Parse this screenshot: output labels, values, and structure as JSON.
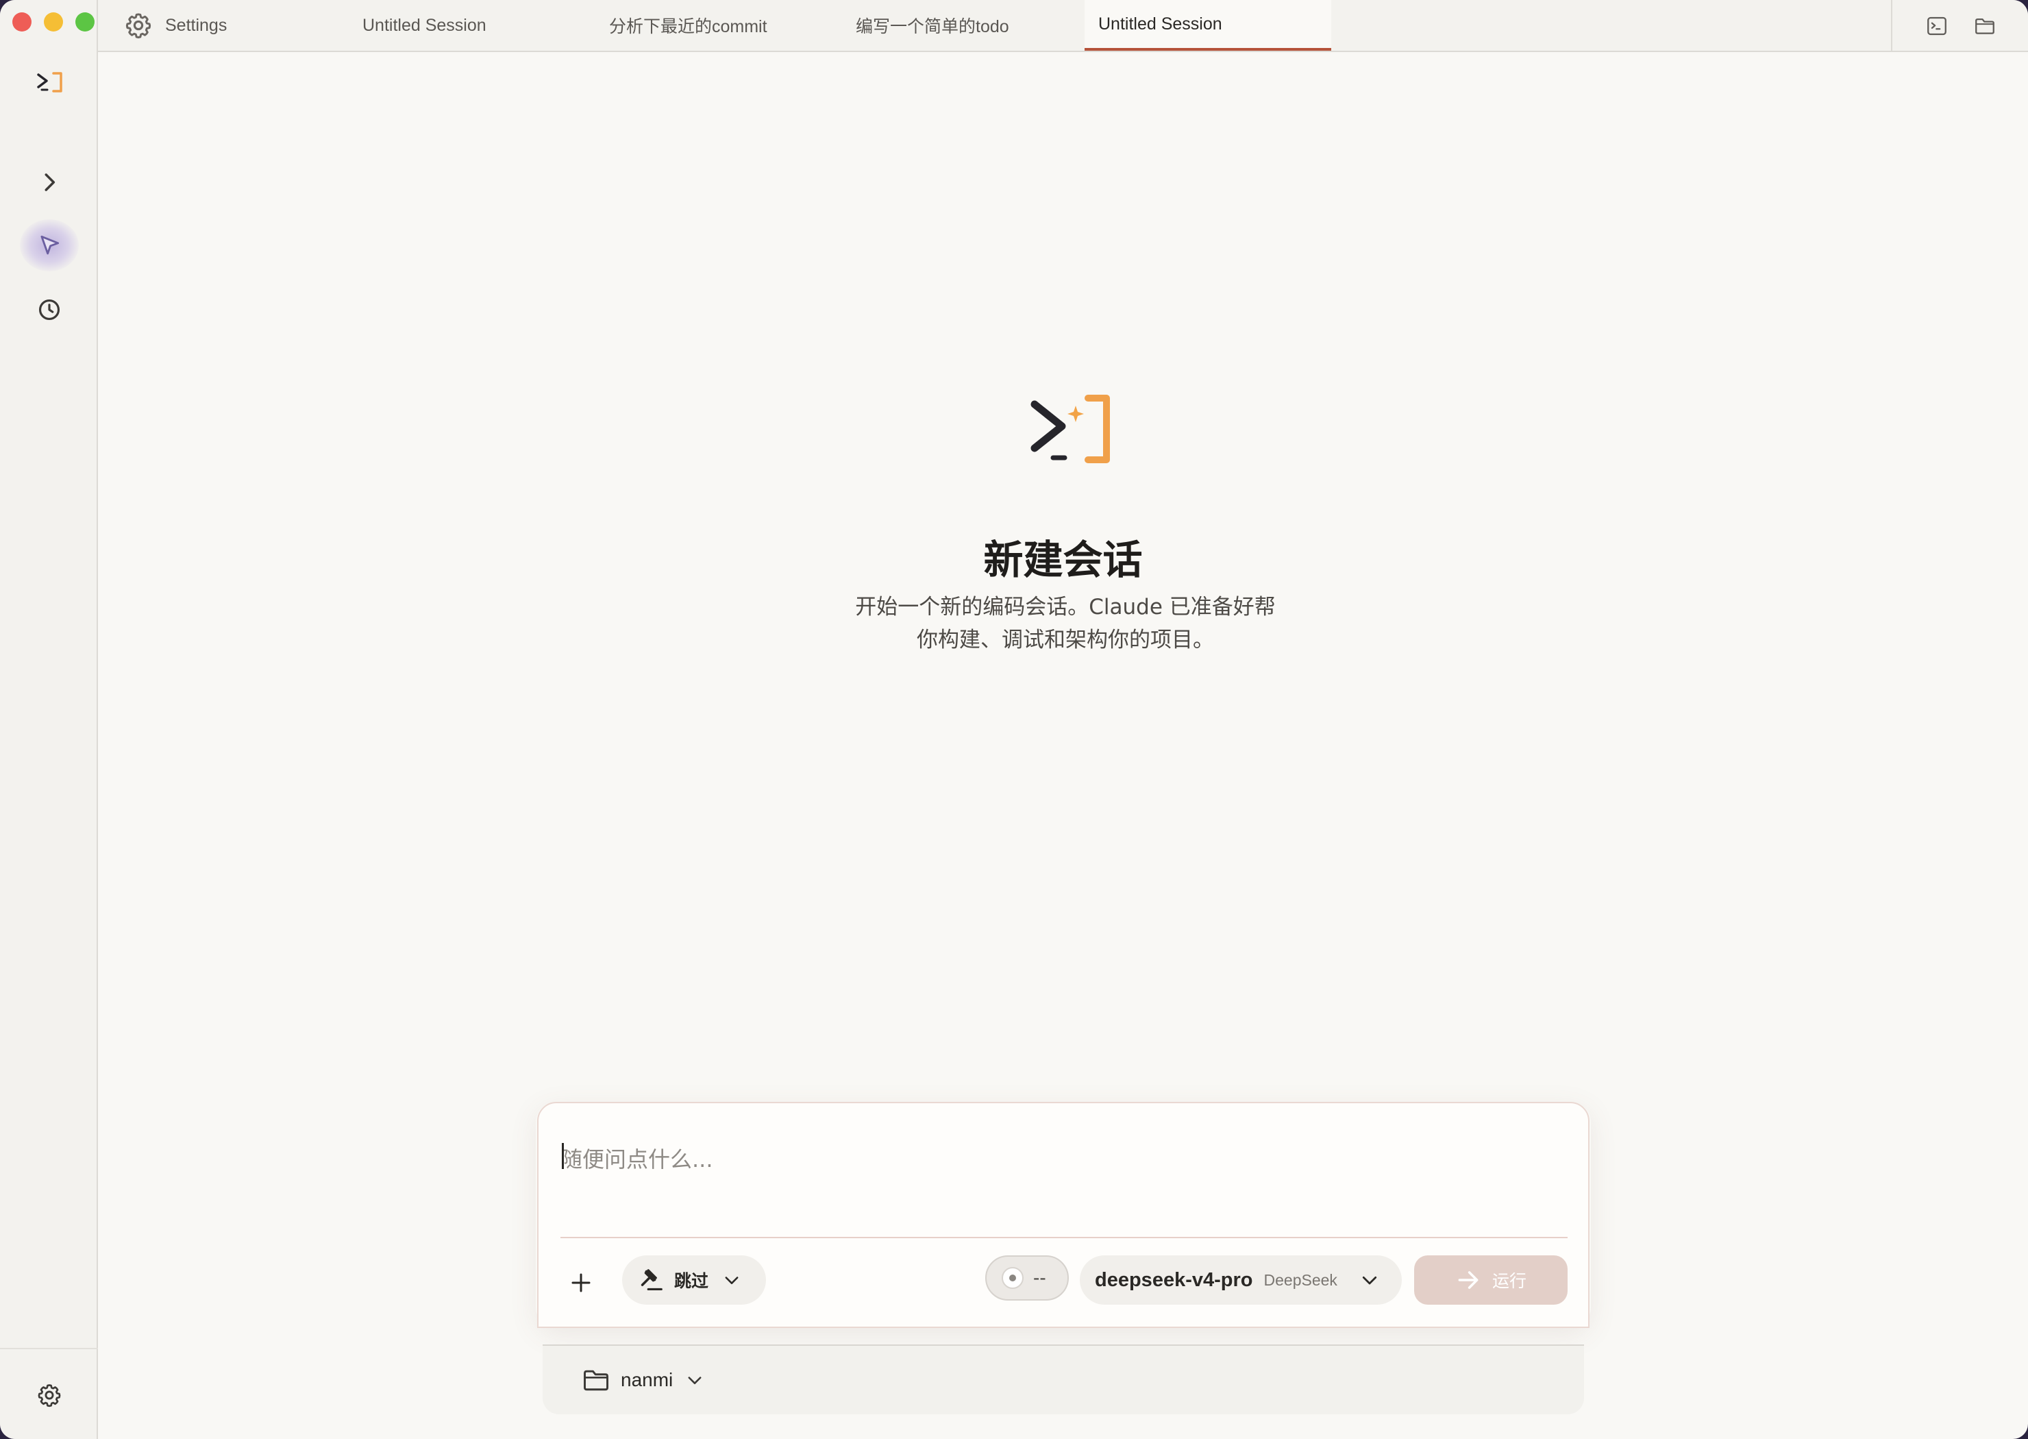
{
  "window": {
    "traffic_lights": [
      "close",
      "minimize",
      "zoom"
    ]
  },
  "tabs": {
    "settings_label": "Settings",
    "items": [
      {
        "label": "Untitled Session",
        "active": false
      },
      {
        "label": "分析下最近的commit",
        "active": false
      },
      {
        "label": "编写一个简单的todo",
        "active": false
      },
      {
        "label": "Untitled Session",
        "active": true
      }
    ],
    "accent_color": "#b5533a"
  },
  "sidebar": {
    "icons": [
      "app-logo-icon",
      "expand-chevron-icon",
      "cursor-icon",
      "history-clock-icon",
      "settings-gear-icon"
    ]
  },
  "hero": {
    "title": "新建会话",
    "subtitle_line1": "开始一个新的编码会话。Claude 已准备好帮",
    "subtitle_line2": "你构建、调试和架构你的项目。",
    "logo_colors": {
      "prompt": "#26252b",
      "bracket": "#f0a04a",
      "sparkle": "#f2a347"
    }
  },
  "composer": {
    "placeholder": "随便问点什么...",
    "value": "",
    "permission_label": "跳过",
    "toggle_label": "--",
    "model_name": "deepseek-v4-pro",
    "model_provider": "DeepSeek",
    "run_label": "运行"
  },
  "folder": {
    "name": "nanmi"
  }
}
